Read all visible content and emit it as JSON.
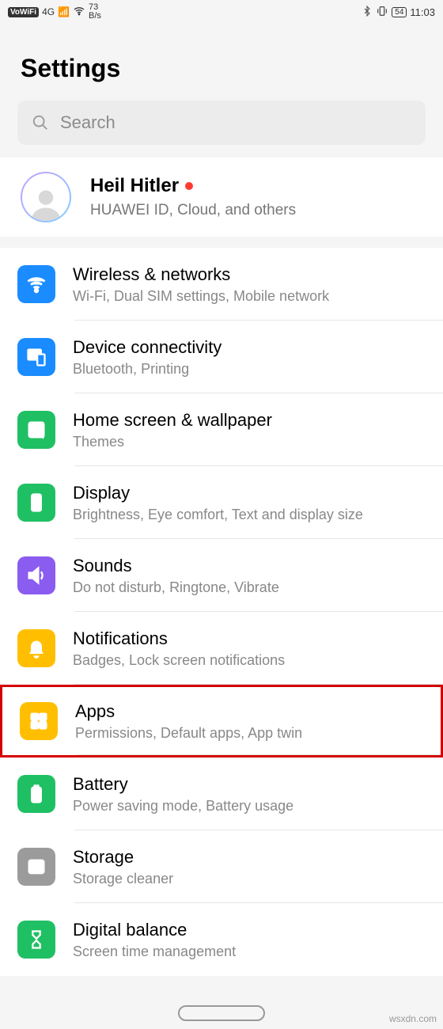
{
  "status": {
    "vowifi": "VoWiFi",
    "net": "4G",
    "speed_num": "73",
    "speed_unit": "B/s",
    "battery": "54",
    "time": "11:03"
  },
  "title": "Settings",
  "search": {
    "placeholder": "Search"
  },
  "account": {
    "name": "Heil Hitler",
    "sub": "HUAWEI ID, Cloud, and others"
  },
  "items": [
    {
      "icon": "wifi",
      "color": "#1a8cff",
      "title": "Wireless & networks",
      "sub": "Wi-Fi, Dual SIM settings, Mobile network",
      "hl": false
    },
    {
      "icon": "devices",
      "color": "#1a8cff",
      "title": "Device connectivity",
      "sub": "Bluetooth, Printing",
      "hl": false
    },
    {
      "icon": "home",
      "color": "#1fc063",
      "title": "Home screen & wallpaper",
      "sub": "Themes",
      "hl": false
    },
    {
      "icon": "display",
      "color": "#1fc063",
      "title": "Display",
      "sub": "Brightness, Eye comfort, Text and display size",
      "hl": false
    },
    {
      "icon": "sound",
      "color": "#8a5cf0",
      "title": "Sounds",
      "sub": "Do not disturb, Ringtone, Vibrate",
      "hl": false
    },
    {
      "icon": "bell",
      "color": "#ffbf00",
      "title": "Notifications",
      "sub": "Badges, Lock screen notifications",
      "hl": false
    },
    {
      "icon": "apps",
      "color": "#ffbf00",
      "title": "Apps",
      "sub": "Permissions, Default apps, App twin",
      "hl": true
    },
    {
      "icon": "battery",
      "color": "#1fc063",
      "title": "Battery",
      "sub": "Power saving mode, Battery usage",
      "hl": false
    },
    {
      "icon": "storage",
      "color": "#9b9b9b",
      "title": "Storage",
      "sub": "Storage cleaner",
      "hl": false
    },
    {
      "icon": "hourglass",
      "color": "#1fc063",
      "title": "Digital balance",
      "sub": "Screen time management",
      "hl": false
    }
  ],
  "watermark": "wsxdn.com"
}
